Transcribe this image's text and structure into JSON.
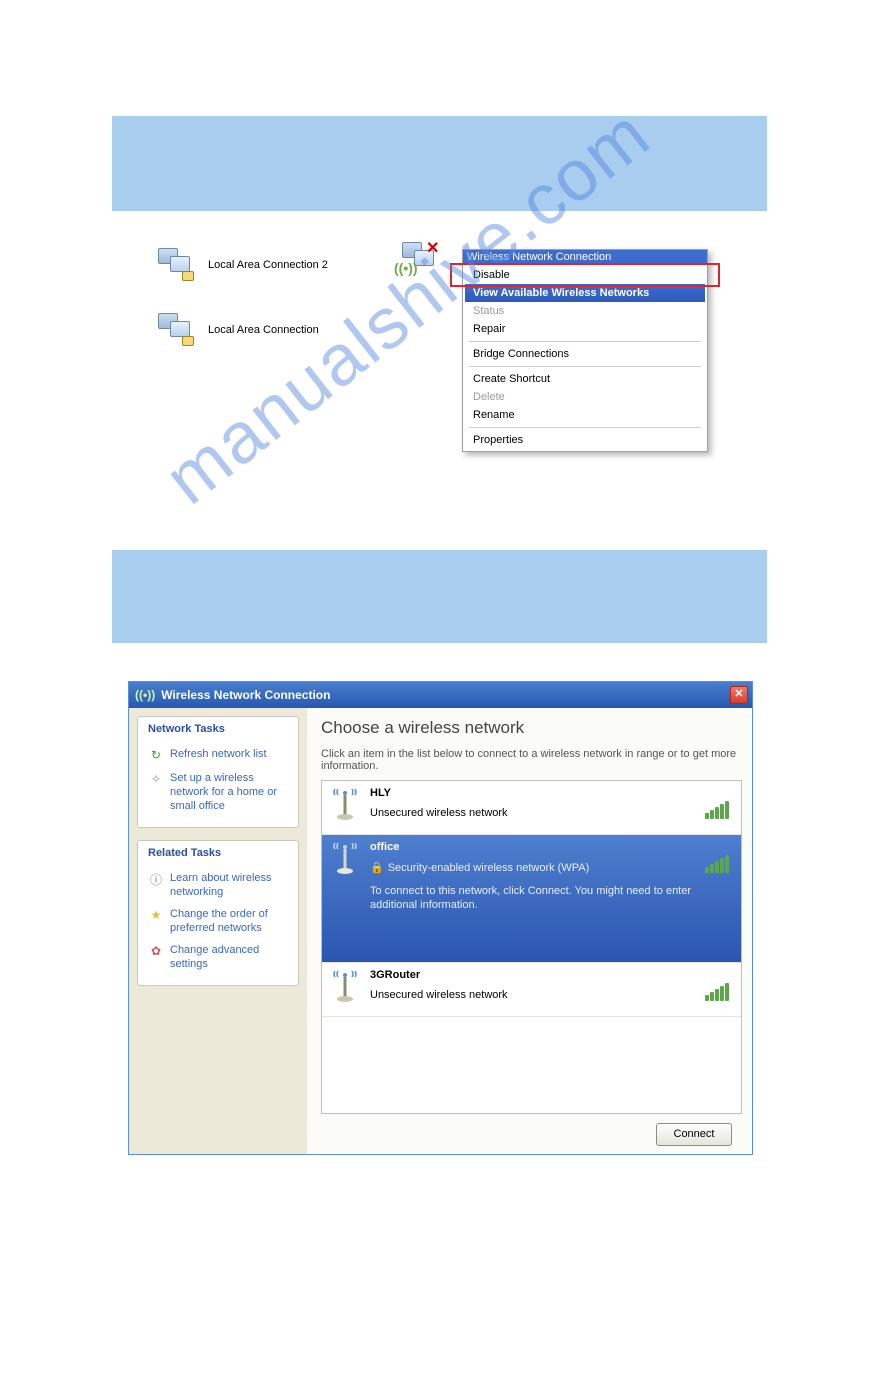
{
  "watermark_text": "manualshive.com",
  "connections": {
    "lan2": "Local Area Connection 2",
    "lan": "Local Area Connection",
    "wlan_label": "Wireless Network Connection"
  },
  "context_menu": {
    "disable": "Disable",
    "view_available": "View Available Wireless Networks",
    "status": "Status",
    "repair": "Repair",
    "bridge": "Bridge Connections",
    "shortcut": "Create Shortcut",
    "delete": "Delete",
    "rename": "Rename",
    "properties": "Properties"
  },
  "wnc": {
    "title": "Wireless Network Connection",
    "choose_header": "Choose a wireless network",
    "choose_sub": "Click an item in the list below to connect to a wireless network in range or to get more information.",
    "tasks_header": "Network Tasks",
    "related_header": "Related Tasks",
    "task_refresh": "Refresh network list",
    "task_setup": "Set up a wireless network for a home or small office",
    "task_learn": "Learn about wireless networking",
    "task_order": "Change the order of preferred networks",
    "task_adv": "Change advanced settings",
    "connect_label": "Connect",
    "networks": [
      {
        "name": "HLY",
        "desc": "Unsecured wireless network",
        "secured": false,
        "selected": false
      },
      {
        "name": "office",
        "desc": "Security-enabled wireless network (WPA)",
        "secured": true,
        "selected": true,
        "extra": "To connect to this network, click Connect. You might need to enter additional information."
      },
      {
        "name": "3GRouter",
        "desc": "Unsecured wireless network",
        "secured": false,
        "selected": false
      }
    ]
  }
}
